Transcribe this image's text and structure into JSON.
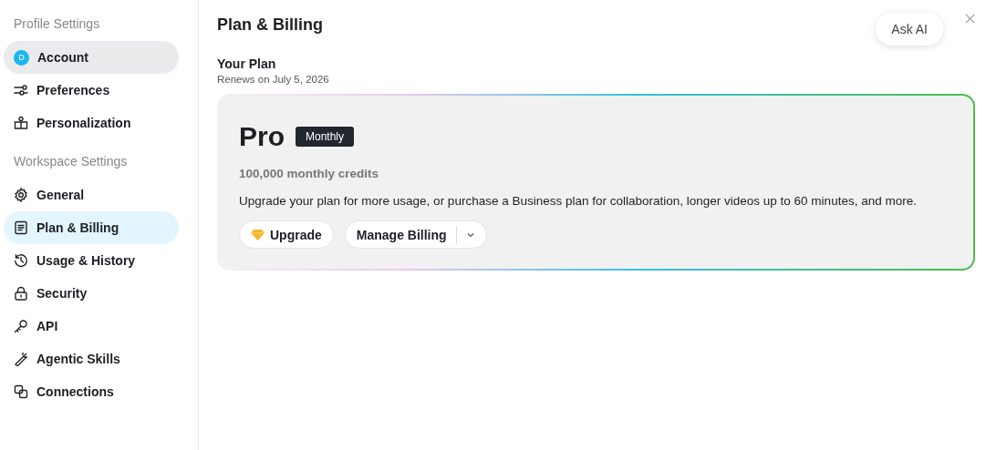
{
  "sidebar": {
    "sections": [
      {
        "heading": "Profile Settings",
        "items": [
          {
            "label": "Account",
            "avatar": "D",
            "selected": false,
            "highlighted": true
          },
          {
            "label": "Preferences",
            "selected": false,
            "highlighted": false
          },
          {
            "label": "Personalization",
            "selected": false,
            "highlighted": false
          }
        ]
      },
      {
        "heading": "Workspace Settings",
        "items": [
          {
            "label": "General",
            "selected": false,
            "highlighted": false
          },
          {
            "label": "Plan & Billing",
            "selected": true,
            "highlighted": false
          },
          {
            "label": "Usage & History",
            "selected": false,
            "highlighted": false
          },
          {
            "label": "Security",
            "selected": false,
            "highlighted": false
          },
          {
            "label": "API",
            "selected": false,
            "highlighted": false
          },
          {
            "label": "Agentic Skills",
            "selected": false,
            "highlighted": false
          },
          {
            "label": "Connections",
            "selected": false,
            "highlighted": false
          }
        ]
      }
    ]
  },
  "page": {
    "title": "Plan & Billing",
    "ask_ai": "Ask AI"
  },
  "plan": {
    "heading": "Your Plan",
    "renewal": "Renews on July 5, 2026",
    "name": "Pro",
    "cycle": "Monthly",
    "credits": "100,000 monthly credits",
    "description": "Upgrade your plan for more usage, or purchase a Business plan for collaboration, longer videos up to 60 minutes, and more.",
    "upgrade": "Upgrade",
    "manage": "Manage Billing"
  }
}
